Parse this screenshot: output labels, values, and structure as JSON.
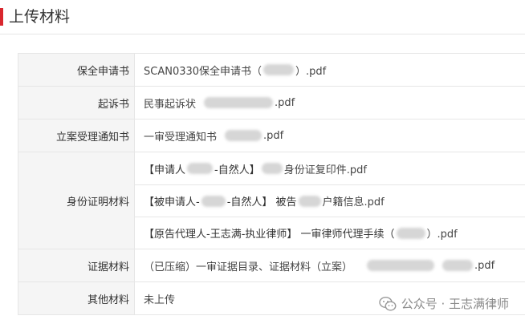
{
  "section": {
    "title": "上传材料"
  },
  "rows": [
    {
      "label": "保全申请书",
      "lines": [
        {
          "a": "SCAN0330保全申请书（",
          "b": "）.pdf"
        }
      ]
    },
    {
      "label": "起诉书",
      "lines": [
        {
          "a": "民事起诉状",
          "b": ".pdf"
        }
      ]
    },
    {
      "label": "立案受理通知书",
      "lines": [
        {
          "a": "一审受理通知书",
          "b": ".pdf"
        }
      ]
    },
    {
      "label": "身份证明材料",
      "lines": [
        {
          "a": "【申请人",
          "b": "-自然人】",
          "c": "身份证复印件.pdf"
        },
        {
          "a": "【被申请人-",
          "b": "-自然人】 被告",
          "c": "户籍信息.pdf"
        },
        {
          "a": "【原告代理人-王志满-执业律师】 一审律师代理手续（",
          "b": "）.pdf"
        }
      ]
    },
    {
      "label": "证据材料",
      "lines": [
        {
          "a": "（已压缩）一审证据目录、证据材料（立案）",
          "b": ".pdf"
        }
      ]
    },
    {
      "label": "其他材料",
      "lines": [
        {
          "a": "未上传"
        }
      ]
    }
  ],
  "watermark": {
    "text": "公众号 · 王志满律师",
    "icon": "wechat-icon"
  },
  "colors": {
    "accent": "#d9272e",
    "label_bg": "#f5f5f5",
    "border": "#e6e6e6"
  }
}
